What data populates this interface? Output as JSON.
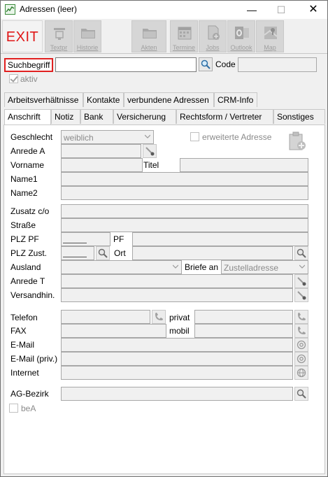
{
  "window": {
    "title": "Adressen (leer)",
    "minimize_glyph": "—",
    "maximize_glyph": "☐",
    "close_glyph": "✕"
  },
  "toolbar": {
    "exit_label": "EXIT",
    "buttons": [
      {
        "id": "textpr",
        "label": "Textpr",
        "icon": "text-template-icon"
      },
      {
        "id": "historie",
        "label": "Historie",
        "icon": "folder-icon"
      },
      {
        "id": "akten",
        "label": "Akten",
        "icon": "folder-icon"
      },
      {
        "id": "termine",
        "label": "Termine",
        "icon": "calendar-icon"
      },
      {
        "id": "jobs",
        "label": "Jobs",
        "icon": "document-add-icon"
      },
      {
        "id": "outlook",
        "label": "Outlook",
        "icon": "outlook-icon"
      },
      {
        "id": "map",
        "label": "Map",
        "icon": "map-icon"
      }
    ]
  },
  "search": {
    "label": "Suchbegriff",
    "value": "",
    "code_label": "Code",
    "code_value": ""
  },
  "aktiv": {
    "label": "aktiv",
    "checked": true
  },
  "tabs_row1": [
    "Arbeitsverhältnisse",
    "Kontakte",
    "verbundene Adressen",
    "CRM-Info"
  ],
  "tabs_row2": [
    "Anschrift",
    "Notiz",
    "Bank",
    "Versicherung",
    "Rechtsform / Vertreter",
    "Sonstiges"
  ],
  "active_tab": "Anschrift",
  "form": {
    "geschlecht_label": "Geschlecht",
    "geschlecht_value": "weiblich",
    "erweiterte_label": "erweiterte Adresse",
    "anrede_a_label": "Anrede A",
    "vorname_label": "Vorname",
    "titel_label": "Titel",
    "name1_label": "Name1",
    "name2_label": "Name2",
    "zusatz_label": "Zusatz  c/o",
    "strasse_label": "Straße",
    "plz_pf_label": "PLZ PF",
    "pf_label": "PF",
    "plz_zust_label": "PLZ Zust.",
    "ort_label": "Ort",
    "ausland_label": "Ausland",
    "briefe_an_label": "Briefe an",
    "briefe_an_value": "Zustelladresse",
    "anrede_t_label": "Anrede T",
    "versandhin_label": "Versandhin.",
    "telefon_label": "Telefon",
    "privat_label": "privat",
    "fax_label": "FAX",
    "mobil_label": "mobil",
    "email_label": "E-Mail",
    "email_priv_label": "E-Mail (priv.)",
    "internet_label": "Internet",
    "ag_bezirk_label": "AG-Bezirk",
    "bea_label": "beA"
  }
}
